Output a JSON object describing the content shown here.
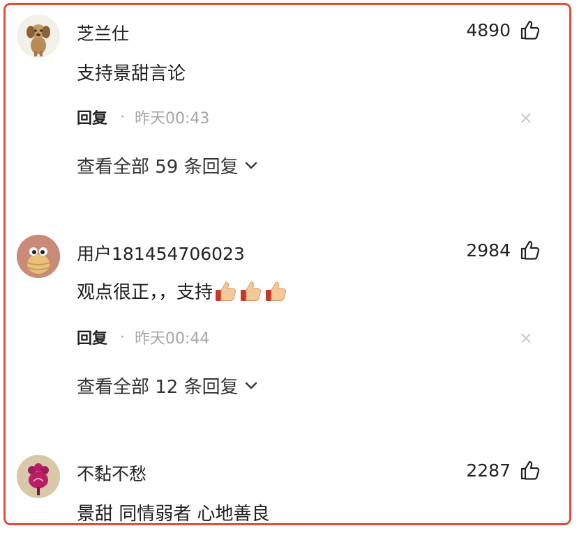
{
  "comments": [
    {
      "username": "芝兰仕",
      "likes": "4890",
      "text": "支持景甜言论",
      "reply_label": "回复",
      "dot": "·",
      "time": "昨天00:43",
      "close": "×",
      "view_replies": "查看全部 59 条回复"
    },
    {
      "username": "用户181454706023",
      "likes": "2984",
      "text": "观点很正，，支持",
      "emoji": [
        "thumbs-up-emoji",
        "thumbs-up-emoji",
        "thumbs-up-emoji"
      ],
      "reply_label": "回复",
      "dot": "·",
      "time": "昨天00:44",
      "close": "×",
      "view_replies": "查看全部 12 条回复"
    },
    {
      "username": "不黏不愁",
      "likes": "2287",
      "text": "景甜 同情弱者 心地善良"
    }
  ],
  "colors": {
    "frame_border": "#e04e3b",
    "muted_text": "#a6a6a6",
    "primary_text": "#222222"
  }
}
